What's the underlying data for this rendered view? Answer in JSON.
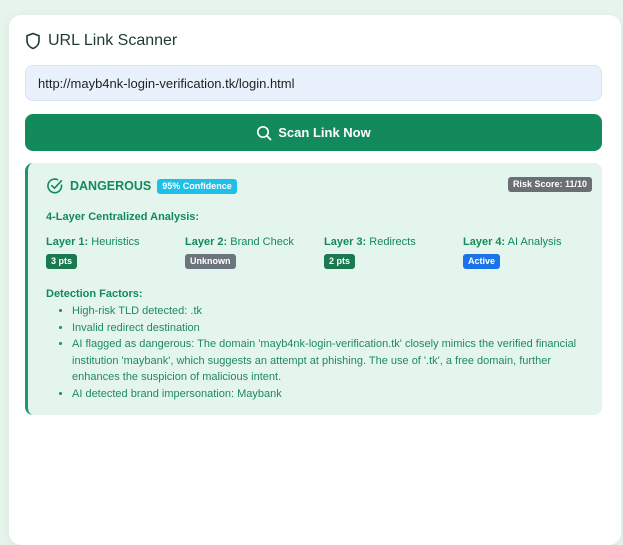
{
  "app": {
    "title": "URL Link Scanner"
  },
  "scan": {
    "url_value": "http://mayb4nk-login-verification.tk/login.html",
    "button_label": "Scan Link Now"
  },
  "result": {
    "status": "DANGEROUS",
    "confidence": "95% Confidence",
    "risk_score": "Risk Score: 11/10",
    "analysis_heading": "4-Layer Centralized Analysis:",
    "layers": [
      {
        "name": "Layer 1:",
        "label": "Heuristics",
        "badge": "3 pts"
      },
      {
        "name": "Layer 2:",
        "label": "Brand Check",
        "badge": "Unknown"
      },
      {
        "name": "Layer 3:",
        "label": "Redirects",
        "badge": "2 pts"
      },
      {
        "name": "Layer 4:",
        "label": "AI Analysis",
        "badge": "Active"
      }
    ],
    "factors_heading": "Detection Factors:",
    "factors": [
      "High-risk TLD detected: .tk",
      "Invalid redirect destination",
      "AI flagged as dangerous: The domain 'mayb4nk-login-verification.tk' closely mimics the verified financial institution 'maybank', which suggests an attempt at phishing. The use of '.tk', a free domain, further enhances the suspicion of malicious intent.",
      "AI detected brand impersonation: Maybank"
    ]
  },
  "colors": {
    "accent": "#128a5c",
    "result_bg": "#e4f5ed",
    "confidence_badge": "#1ec0e8",
    "risk_badge": "#6b6f73",
    "active_badge": "#1a73e8"
  },
  "icons": {
    "title": "shield-icon",
    "scan_button": "search-icon",
    "status": "check-circle-icon"
  }
}
